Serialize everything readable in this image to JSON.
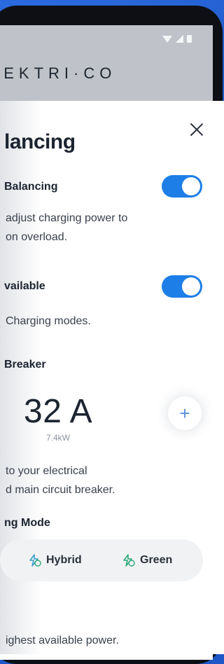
{
  "app": {
    "brand": "LEKTRI·CO"
  },
  "modal": {
    "title": "lancing",
    "load_balancing": {
      "label": "Balancing",
      "desc_line1": "adjust charging power to",
      "desc_line2": "on overload.",
      "enabled": true
    },
    "available": {
      "label": "vailable",
      "desc": "Charging modes.",
      "enabled": true
    },
    "breaker": {
      "label": "Breaker",
      "value": "32 A",
      "power": "7.4kW",
      "increase": "+",
      "desc_line1": "to your electrical",
      "desc_line2": "d main circuit breaker."
    },
    "charging_mode": {
      "label": "ng Mode",
      "options": [
        "Hybrid",
        "Green"
      ],
      "desc": "ighest available power."
    }
  },
  "colors": {
    "accent": "#1e7ee8",
    "icon_green": "#2eaa7a"
  }
}
